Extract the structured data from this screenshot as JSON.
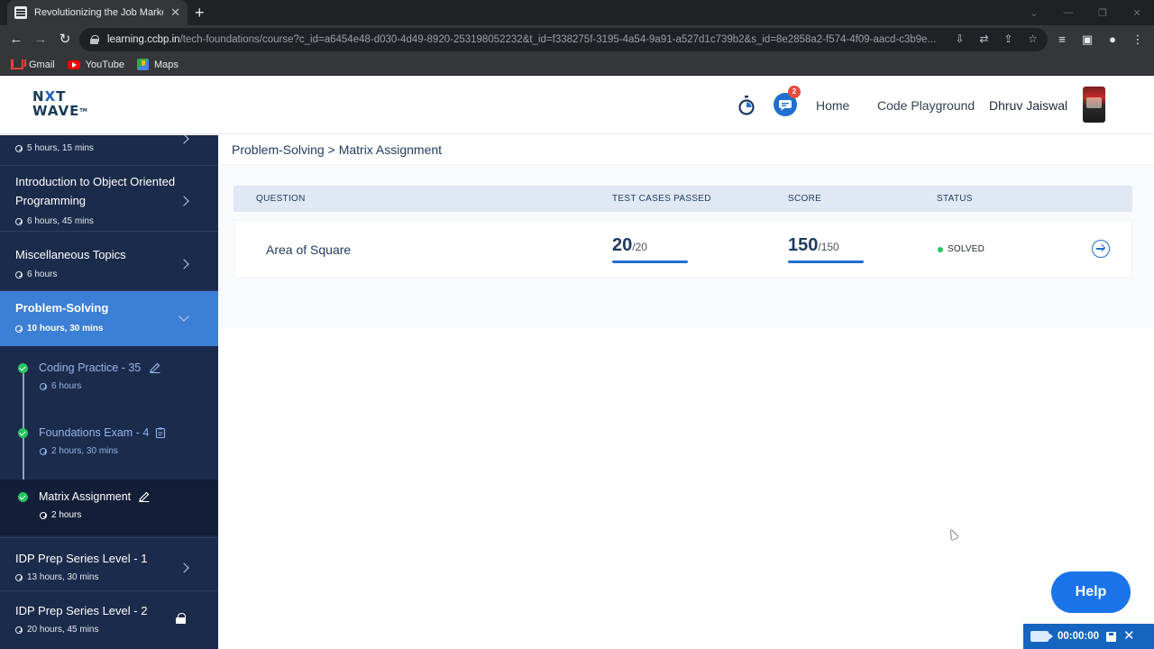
{
  "browser": {
    "tab_title": "Revolutionizing the Job Market |",
    "tab_close": "✕",
    "new_tab": "+",
    "url_host": "learning.ccbp.in",
    "url_path": "/tech-foundations/course?c_id=a6454e48-d030-4d49-8920-253198052232&t_id=f338275f-3195-4a54-9a91-a527d1c739b2&s_id=8e2858a2-f574-4f09-aacd-c3b9e...",
    "bookmarks": [
      "Gmail",
      "YouTube",
      "Maps"
    ]
  },
  "header": {
    "logo_top_left": "N",
    "logo_top_x": "X",
    "logo_top_right": "T",
    "logo_bottom": "WAVE",
    "logo_tm": "TM",
    "notification_count": "2",
    "nav_home": "Home",
    "nav_playground": "Code Playground",
    "user_name": "Dhruv Jaiswal"
  },
  "sidebar": {
    "items": [
      {
        "title": "",
        "duration": "5 hours, 15 mins"
      },
      {
        "title": "Introduction to Object Oriented Programming",
        "duration": "6 hours, 45 mins"
      },
      {
        "title": "Miscellaneous Topics",
        "duration": "6 hours"
      },
      {
        "title": "Problem-Solving",
        "duration": "10 hours, 30 mins"
      },
      {
        "title": "IDP Prep Series Level - 1",
        "duration": "13 hours, 30 mins"
      },
      {
        "title": "IDP Prep Series Level - 2",
        "duration": "20 hours, 45 mins"
      }
    ],
    "sub_items": [
      {
        "title": "Coding Practice - 35",
        "duration": "6 hours"
      },
      {
        "title": "Foundations Exam - 4",
        "duration": "2 hours, 30 mins"
      },
      {
        "title": "Matrix Assignment",
        "duration": "2 hours"
      }
    ]
  },
  "breadcrumb": {
    "parent": "Problem-Solving",
    "separator": " > ",
    "current": "Matrix Assignment"
  },
  "table": {
    "headers": [
      "QUESTION",
      "TEST CASES PASSED",
      "SCORE",
      "STATUS"
    ],
    "rows": [
      {
        "question": "Area of Square",
        "tests_passed": "20",
        "tests_total": "/20",
        "score": "150",
        "score_total": "/150",
        "status": "SOLVED"
      }
    ]
  },
  "help_label": "Help",
  "recorder": {
    "time": "00:00:00",
    "close": "✕"
  },
  "colors": {
    "accent": "#1f6fd1",
    "sidebar_bg": "#1b2b4b",
    "sidebar_active": "#3b7fd6",
    "solved": "#22c55e"
  }
}
